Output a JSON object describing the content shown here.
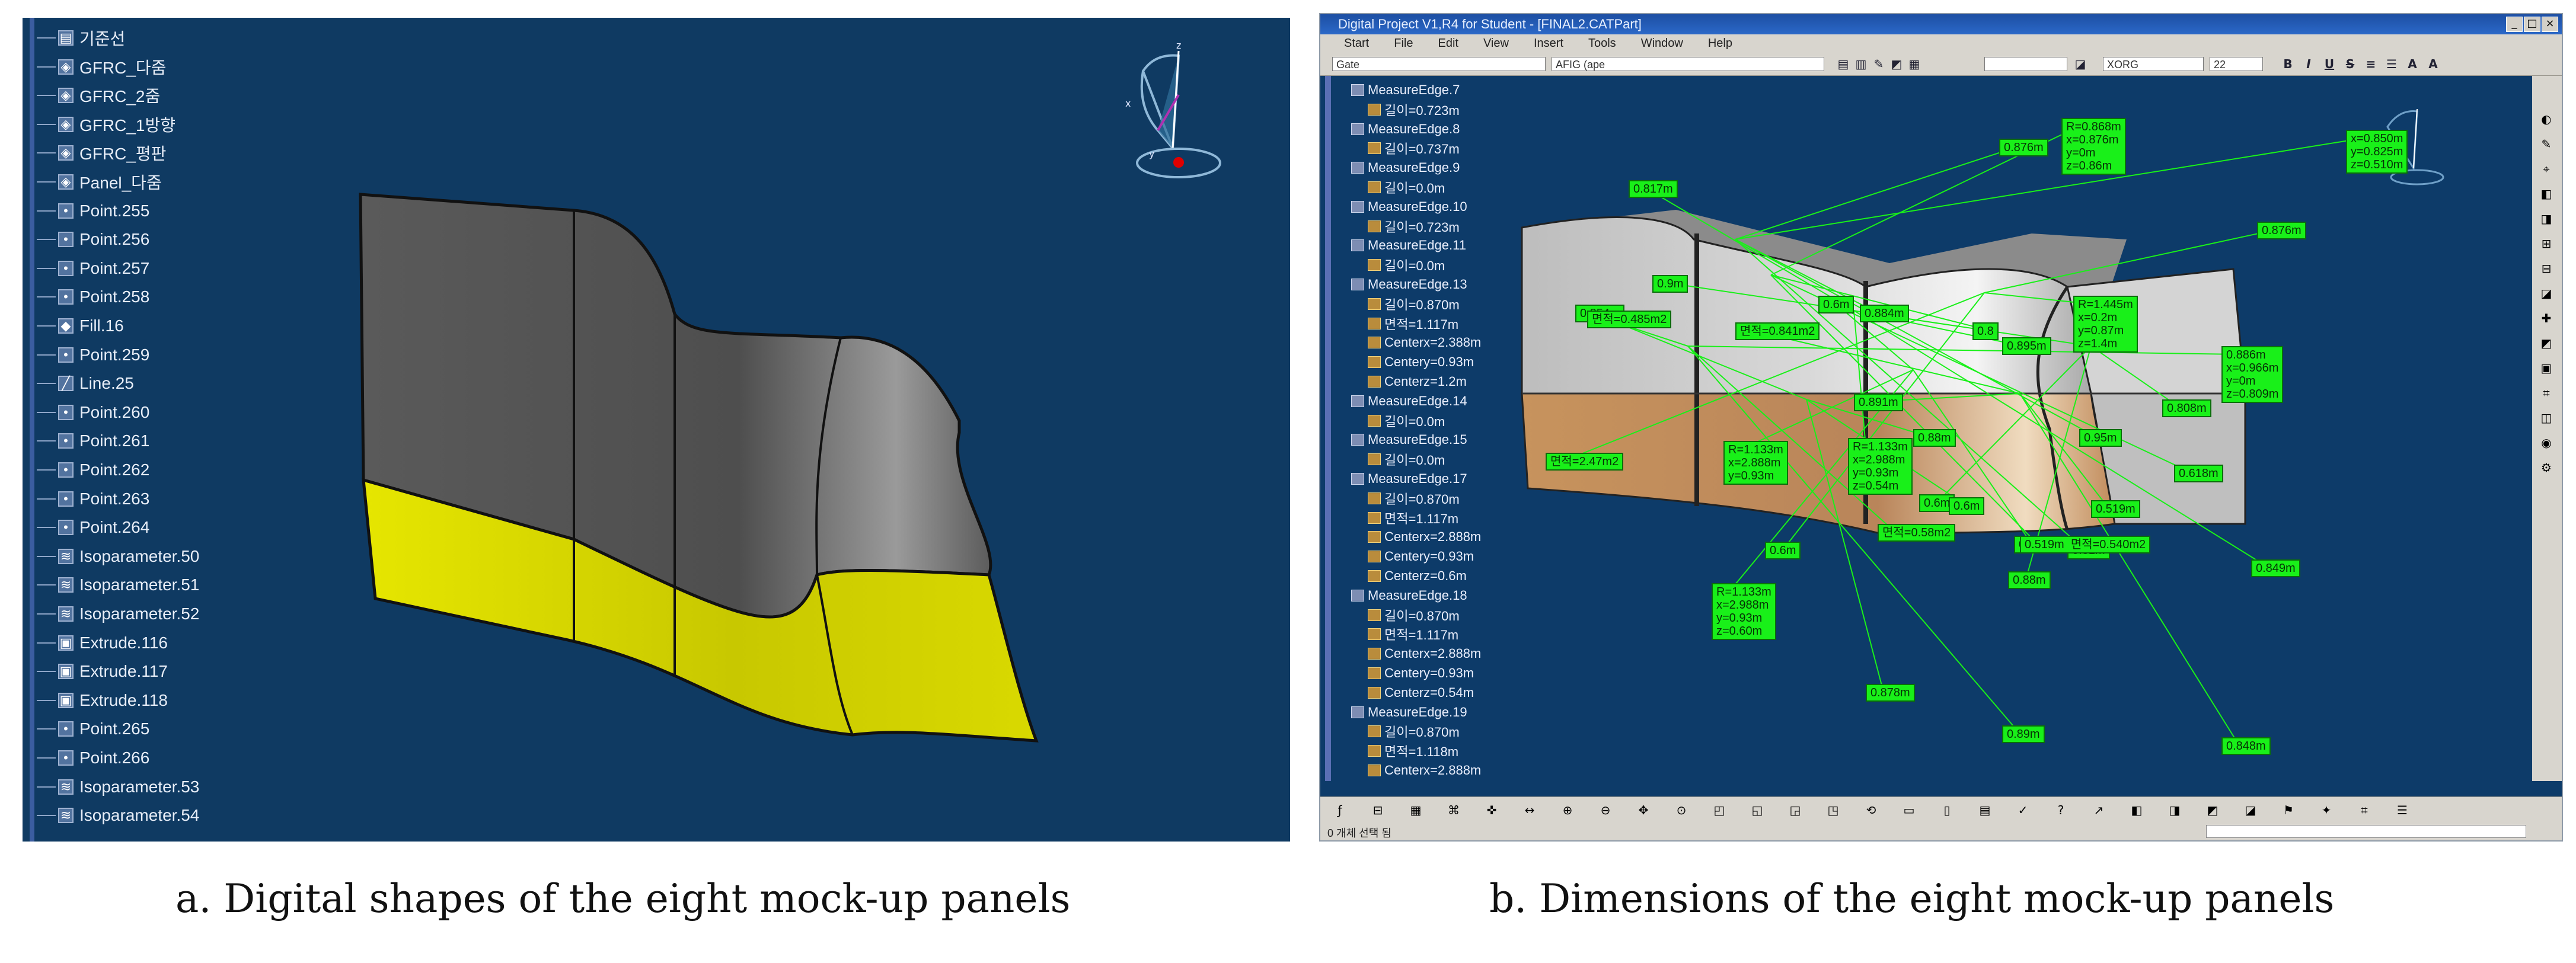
{
  "captions": {
    "a": "a. Digital shapes of the eight mock-up panels",
    "b": "b. Dimensions of the eight mock-up panels"
  },
  "panel_a": {
    "tree_items": [
      {
        "label": "기준선",
        "icon": "folder"
      },
      {
        "label": "GFRC_다줌",
        "icon": "geoset"
      },
      {
        "label": "GFRC_2줌",
        "icon": "geoset"
      },
      {
        "label": "GFRC_1방향",
        "icon": "geoset"
      },
      {
        "label": "GFRC_평판",
        "icon": "geoset"
      },
      {
        "label": "Panel_다줌",
        "icon": "geoset"
      },
      {
        "label": "Point.255",
        "icon": "point"
      },
      {
        "label": "Point.256",
        "icon": "point"
      },
      {
        "label": "Point.257",
        "icon": "point"
      },
      {
        "label": "Point.258",
        "icon": "point"
      },
      {
        "label": "Fill.16",
        "icon": "fill"
      },
      {
        "label": "Point.259",
        "icon": "point"
      },
      {
        "label": "Line.25",
        "icon": "line"
      },
      {
        "label": "Point.260",
        "icon": "point"
      },
      {
        "label": "Point.261",
        "icon": "point"
      },
      {
        "label": "Point.262",
        "icon": "point"
      },
      {
        "label": "Point.263",
        "icon": "point"
      },
      {
        "label": "Point.264",
        "icon": "point"
      },
      {
        "label": "Isoparameter.50",
        "icon": "iso"
      },
      {
        "label": "Isoparameter.51",
        "icon": "iso"
      },
      {
        "label": "Isoparameter.52",
        "icon": "iso"
      },
      {
        "label": "Extrude.116",
        "icon": "extrude"
      },
      {
        "label": "Extrude.117",
        "icon": "extrude"
      },
      {
        "label": "Extrude.118",
        "icon": "extrude"
      },
      {
        "label": "Point.265",
        "icon": "point"
      },
      {
        "label": "Point.266",
        "icon": "point"
      },
      {
        "label": "Isoparameter.53",
        "icon": "iso"
      },
      {
        "label": "Isoparameter.54",
        "icon": "iso"
      }
    ],
    "colors": {
      "background": "#0f3a62",
      "upper_panels": "#595959",
      "lower_panels": "#d6d600"
    }
  },
  "panel_b": {
    "window_title": "Digital Project V1,R4 for Student - [FINAL2.CATPart]",
    "menu": [
      "Start",
      "File",
      "Edit",
      "View",
      "Insert",
      "Tools",
      "Window",
      "Help"
    ],
    "toolbar": {
      "combo1": "Gate",
      "combo2": "AFIG (ape",
      "combo3": "XORG",
      "combo4": "22",
      "bold": "B",
      "italic": "I",
      "underline": "U",
      "strike": "S",
      "align": "A"
    },
    "spec_tree": [
      {
        "label": "MeasureEdge.7",
        "type": "edge"
      },
      {
        "label": "길이=0.723m",
        "type": "param"
      },
      {
        "label": "MeasureEdge.8",
        "type": "edge"
      },
      {
        "label": "길이=0.737m",
        "type": "param"
      },
      {
        "label": "MeasureEdge.9",
        "type": "edge"
      },
      {
        "label": "길이=0.0m",
        "type": "param"
      },
      {
        "label": "MeasureEdge.10",
        "type": "edge"
      },
      {
        "label": "길이=0.723m",
        "type": "param"
      },
      {
        "label": "MeasureEdge.11",
        "type": "edge"
      },
      {
        "label": "길이=0.0m",
        "type": "param"
      },
      {
        "label": "MeasureEdge.13",
        "type": "edge"
      },
      {
        "label": "길이=0.870m",
        "type": "param"
      },
      {
        "label": "면적=1.117m",
        "type": "param"
      },
      {
        "label": "Centerx=2.388m",
        "type": "param"
      },
      {
        "label": "Centery=0.93m",
        "type": "param"
      },
      {
        "label": "Centerz=1.2m",
        "type": "param"
      },
      {
        "label": "MeasureEdge.14",
        "type": "edge"
      },
      {
        "label": "길이=0.0m",
        "type": "param"
      },
      {
        "label": "MeasureEdge.15",
        "type": "edge"
      },
      {
        "label": "길이=0.0m",
        "type": "param"
      },
      {
        "label": "MeasureEdge.17",
        "type": "edge"
      },
      {
        "label": "길이=0.870m",
        "type": "param"
      },
      {
        "label": "면적=1.117m",
        "type": "param"
      },
      {
        "label": "Centerx=2.888m",
        "type": "param"
      },
      {
        "label": "Centery=0.93m",
        "type": "param"
      },
      {
        "label": "Centerz=0.6m",
        "type": "param"
      },
      {
        "label": "MeasureEdge.18",
        "type": "edge"
      },
      {
        "label": "길이=0.870m",
        "type": "param"
      },
      {
        "label": "면적=1.117m",
        "type": "param"
      },
      {
        "label": "Centerx=2.888m",
        "type": "param"
      },
      {
        "label": "Centery=0.93m",
        "type": "param"
      },
      {
        "label": "Centerz=0.54m",
        "type": "param"
      },
      {
        "label": "MeasureEdge.19",
        "type": "edge"
      },
      {
        "label": "길이=0.870m",
        "type": "param"
      },
      {
        "label": "면적=1.118m",
        "type": "param"
      },
      {
        "label": "Centerx=2.888m",
        "type": "param"
      }
    ],
    "labels": [
      "0.876m",
      "R=0.868m\nx=0.876m\ny=0m\nz=0.86m",
      "0.817m",
      "0.876m",
      "0.9m",
      "0.6m",
      "0.854m",
      "면적=0.485m2",
      "면적=0.841m2",
      "0.884m",
      "0.8",
      "0.895m",
      "R=1.445m\nx=0.2m\ny=0.87m\nz=1.4m",
      "0.808m",
      "R=1.133m\nx=2.888m\ny=0.93m",
      "0.88m",
      "0.886m\nx=0.966m\ny=0m\nz=0.809m",
      "0.891m",
      "0.95m",
      "0.618m",
      "R=1.133m\nx=2.988m\ny=0.93m\nz=0.54m",
      "면적=2.47m2",
      "0.6m",
      "0.878m",
      "0.6m",
      "면적=0.58m2",
      "0.519m",
      "0.81m",
      "0.519m  면적=0.540m2",
      "0.849m",
      "0.6m",
      "0.88m",
      "R=1.133m\nx=2.988m\ny=0.93m\nz=0.60m",
      "0.878m",
      "0.89m",
      "0.848m",
      "x=0.850m\ny=0.825m\nz=0.510m"
    ],
    "status_text": "0 개체 선택 됨",
    "colors": {
      "viewport": "#0d3b69",
      "label_fill": "#19f019",
      "upper_panels": "#c7c7c7",
      "lower_panels": "#c8965f"
    }
  }
}
